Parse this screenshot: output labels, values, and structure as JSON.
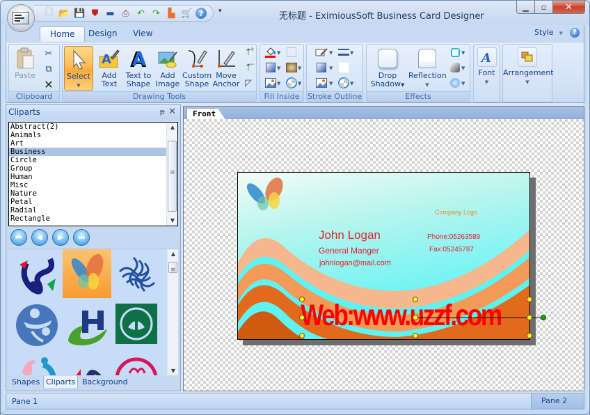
{
  "window": {
    "title": "无标题 - EximiousSoft Business Card Designer",
    "controls": {
      "minimize": "▁",
      "maximize": "▫",
      "close": "✕"
    }
  },
  "quick_access": [
    {
      "name": "new-file-icon",
      "glyph": "🗋"
    },
    {
      "name": "open-folder-icon",
      "glyph": "📂"
    },
    {
      "name": "save-icon",
      "glyph": "💾"
    },
    {
      "name": "export-pdf-icon",
      "glyph": "⛊"
    },
    {
      "name": "export-image-icon",
      "glyph": "▬"
    },
    {
      "name": "print-icon",
      "glyph": "⎙"
    },
    {
      "name": "undo-icon",
      "glyph": "↶"
    },
    {
      "name": "redo-icon",
      "glyph": "↷"
    },
    {
      "name": "eraser-icon",
      "glyph": "▙"
    },
    {
      "name": "cart-icon",
      "glyph": "🛒"
    },
    {
      "name": "help-icon",
      "glyph": "?"
    }
  ],
  "qat_more": "▾",
  "ribbon": {
    "tabs": [
      {
        "label": "Home",
        "active": true
      },
      {
        "label": "Design",
        "active": false
      },
      {
        "label": "View",
        "active": false
      }
    ],
    "style_label": "Style",
    "style_arrow": "▼",
    "help": "?",
    "groups": {
      "clipboard": {
        "label": "Clipboard",
        "paste": "Paste",
        "cut_icon": "✂",
        "copy_icon": "⧉",
        "delete_icon": "✕"
      },
      "drawing_tools": {
        "label": "Drawing Tools",
        "buttons": [
          {
            "line1": "Select",
            "line2": "",
            "has_caret": true
          },
          {
            "line1": "Add",
            "line2": "Text"
          },
          {
            "line1": "Text to",
            "line2": "Shape"
          },
          {
            "line1": "Add",
            "line2": "Image"
          },
          {
            "line1": "Custom",
            "line2": "Shape"
          },
          {
            "line1": "Move",
            "line2": "Anchor"
          }
        ]
      },
      "fill_inside": {
        "label": "Fill Inside"
      },
      "stroke_outline": {
        "label": "Stroke Outline"
      },
      "effects": {
        "label": "Effects",
        "drop_shadow": [
          "Drop",
          "Shadow"
        ],
        "reflection": "Reflection"
      },
      "font": {
        "label": "Font"
      },
      "arrangement": {
        "label": "Arrangement"
      }
    },
    "caret": "▼"
  },
  "cliparts_pane": {
    "title": "Cliparts",
    "pin": "ᵽ",
    "close": "✕",
    "categories": [
      "Abstract(2)",
      "Animals",
      "Art",
      "Business",
      "Circle",
      "Group",
      "Human",
      "Misc",
      "Nature",
      "Petal",
      "Radial",
      "Rectangle"
    ],
    "selected_category": "Business",
    "nav": [
      "⏮",
      "◀",
      "▶",
      "⏭"
    ],
    "bottom_tabs": [
      {
        "label": "Shapes",
        "active": false
      },
      {
        "label": "Cliparts",
        "active": true
      },
      {
        "label": "Background",
        "active": false
      }
    ]
  },
  "document": {
    "tab": "Front",
    "card": {
      "company_logo": "Company Logo",
      "name": "John Logan",
      "job_title": "General Manger",
      "email": "johnlogan@mail.com",
      "phone": "Phone:05263589",
      "fax": "Fax:05245787",
      "web": "Web:www.uzzf.com",
      "colors": {
        "text_red": "#e8202a",
        "logo_orange": "#e98a2c",
        "web_red": "#ff0000"
      }
    }
  },
  "status": {
    "left": "Pane 1",
    "right": "Pane 2"
  }
}
